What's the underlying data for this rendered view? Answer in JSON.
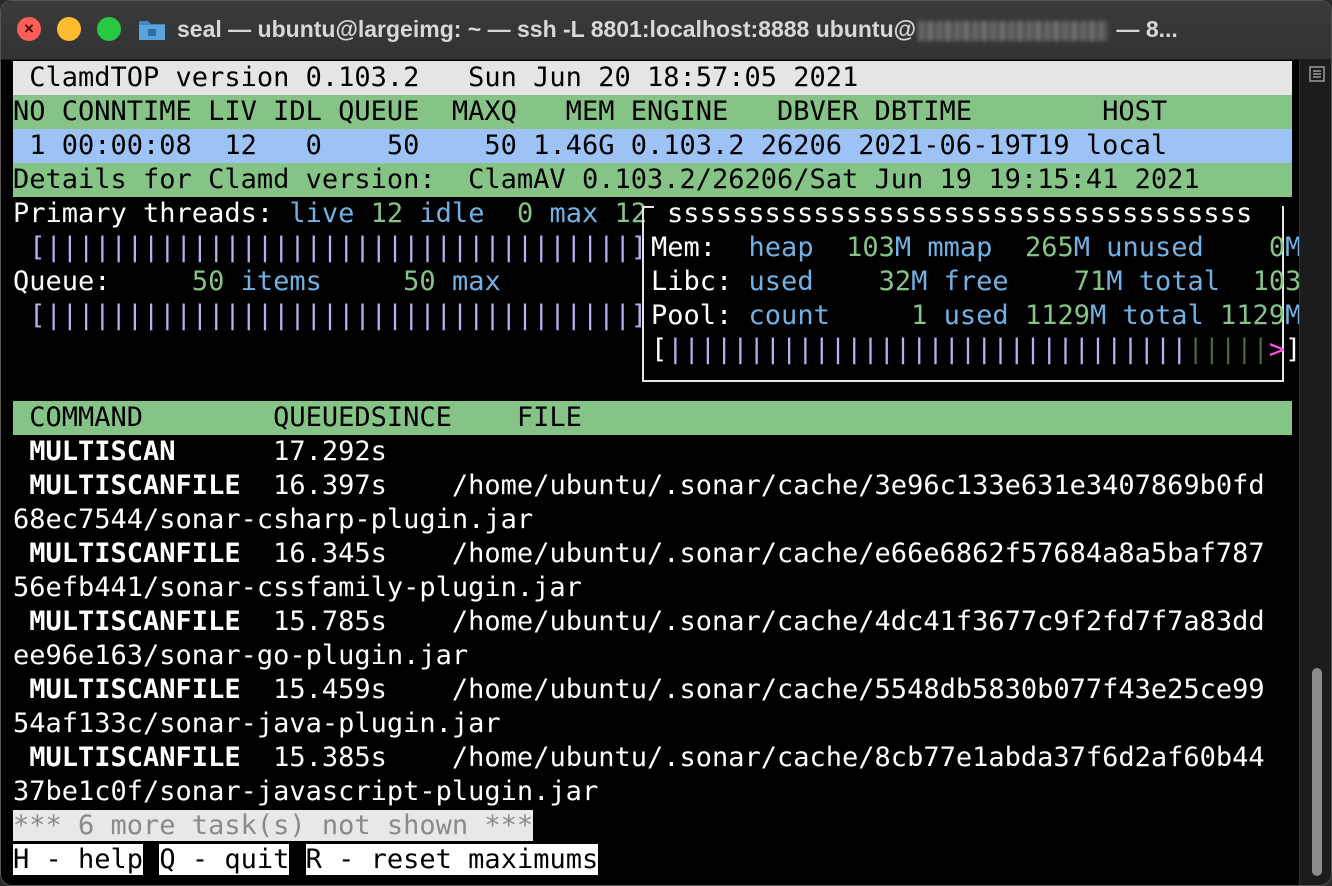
{
  "window": {
    "title_prefix": "seal — ubuntu@largeimg: ~ — ssh -L 8801:localhost:8888 ubuntu@",
    "title_suffix": " — 8..."
  },
  "header": {
    "version_line": " ClamdTOP version 0.103.2   Sun Jun 20 18:57:05 2021",
    "columns": "NO CONNTIME LIV IDL QUEUE  MAXQ   MEM ENGINE   DBVER DBTIME        HOST",
    "row": " 1 00:00:08  12   0    50    50 1.46G 0.103.2 26206 2021-06-19T19 local",
    "details": "Details for Clamd version:  ClamAV 0.103.2/26206/Sat Jun 19 19:15:41 2021"
  },
  "threads": {
    "label": "Primary threads: ",
    "live_label": "live",
    "live_value": "12",
    "idle_label": "idle",
    "idle_value": "0",
    "max_label": "max",
    "max_value": "12",
    "bar": " [||||||||||||||||||||||||||||||||||||]"
  },
  "queue": {
    "label": "Queue:",
    "items_value": "50",
    "items_label": "items",
    "max_value": "50",
    "max_label": "max",
    "bar": " [||||||||||||||||||||||||||||||||||||]"
  },
  "memory": {
    "box_top": "ssssssssssssssssssssssssssssssssssss",
    "mem_label": "Mem:",
    "heap_label": "heap",
    "heap_value": "103",
    "mmap_label": "mmap",
    "mmap_value": "265",
    "unused_label": "unused",
    "unused_value": "0",
    "libc_label": "Libc:",
    "used_label": "used",
    "used_value": "32",
    "free_label": "free",
    "free_value": "71",
    "total_label": "total",
    "libc_total_value": "103",
    "pool_label": "Pool:",
    "count_label": "count",
    "count_value": "1",
    "pool_used_label": "used",
    "pool_used_value": "1129",
    "pool_total_label": "total",
    "pool_total_value": "1129",
    "unit": "M",
    "bar_open": "[",
    "bar_fill": "||||||||||||||||||||||||||||||||",
    "bar_empty": "|||||",
    "bar_arrow": ">",
    "bar_close": "]"
  },
  "tasks": {
    "columns": " COMMAND        QUEUEDSINCE    FILE",
    "rows": [
      {
        "command": " MULTISCAN",
        "since": "      17.292s",
        "file": "",
        "file_cont": ""
      },
      {
        "command": " MULTISCANFILE",
        "since": "  16.397s",
        "file": "    /home/ubuntu/.sonar/cache/3e96c133e631e3407869b0fd",
        "file_cont": "68ec7544/sonar-csharp-plugin.jar"
      },
      {
        "command": " MULTISCANFILE",
        "since": "  16.345s",
        "file": "    /home/ubuntu/.sonar/cache/e66e6862f57684a8a5baf787",
        "file_cont": "56efb441/sonar-cssfamily-plugin.jar"
      },
      {
        "command": " MULTISCANFILE",
        "since": "  15.785s",
        "file": "    /home/ubuntu/.sonar/cache/4dc41f3677c9f2fd7f7a83dd",
        "file_cont": "ee96e163/sonar-go-plugin.jar"
      },
      {
        "command": " MULTISCANFILE",
        "since": "  15.459s",
        "file": "    /home/ubuntu/.sonar/cache/5548db5830b077f43e25ce99",
        "file_cont": "54af133c/sonar-java-plugin.jar"
      },
      {
        "command": " MULTISCANFILE",
        "since": "  15.385s",
        "file": "    /home/ubuntu/.sonar/cache/8cb77e1abda37f6d2af60b44",
        "file_cont": "37be1c0f/sonar-javascript-plugin.jar"
      }
    ],
    "more": "*** 6 more task(s) not shown ***"
  },
  "footer": {
    "help": "H - help",
    "quit": "Q - quit",
    "reset": "R - reset maximums"
  },
  "colors": {
    "header_green": "#86c387",
    "row_blue": "#9dc3f6",
    "label_cyan": "#72b1e3",
    "value_green": "#86c387",
    "bar_violet": "#b5b0f0",
    "arrow_magenta": "#ff56e5"
  }
}
